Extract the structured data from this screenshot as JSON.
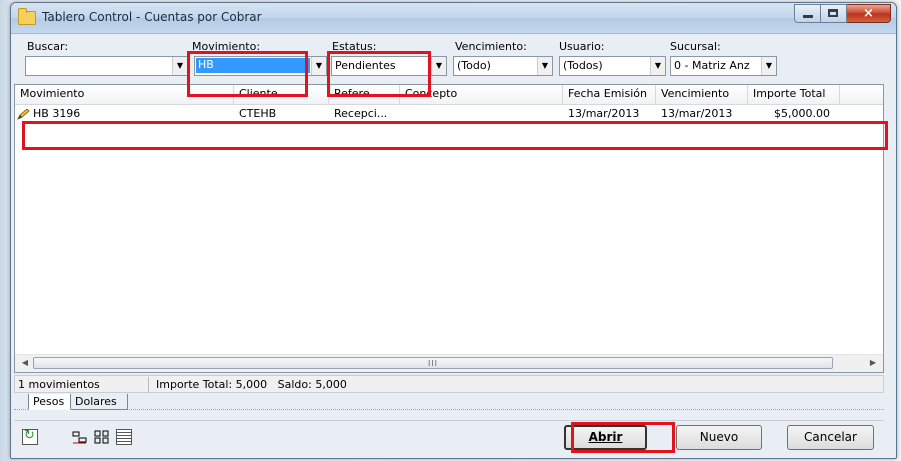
{
  "window": {
    "title": "Tablero Control - Cuentas por Cobrar"
  },
  "filters": {
    "buscar": {
      "label": "Buscar:",
      "value": ""
    },
    "movimiento": {
      "label": "Movimiento:",
      "value": "HB"
    },
    "estatus": {
      "label": "Estatus:",
      "value": "Pendientes"
    },
    "vencimiento": {
      "label": "Vencimiento:",
      "value": "(Todo)"
    },
    "usuario": {
      "label": "Usuario:",
      "value": "(Todos)"
    },
    "sucursal": {
      "label": "Sucursal:",
      "value": "0 - Matriz Anz"
    }
  },
  "grid": {
    "columns": [
      "Movimiento",
      "Cliente",
      "Refere...",
      "Concepto",
      "Fecha Emisión",
      "Vencimiento",
      "Importe Total"
    ],
    "rows": [
      {
        "movimiento": "HB 3196",
        "cliente": "CTEHB",
        "referencia": "Recepci...",
        "concepto": "",
        "fecha_emision": "13/mar/2013",
        "vencimiento": "13/mar/2013",
        "importe_total": "$5,000.00"
      }
    ],
    "scroll_grip": "III"
  },
  "status": {
    "count": "1 movimientos",
    "totals": "Importe Total: 5,000   Saldo: 5,000"
  },
  "tabs": {
    "pesos": "Pesos",
    "dolares": "Dolares"
  },
  "buttons": {
    "abrir": "Abrir",
    "nuevo": "Nuevo",
    "cancelar": "Cancelar"
  },
  "colors": {
    "highlight": "#e0141e",
    "selection": "#3399ff"
  }
}
